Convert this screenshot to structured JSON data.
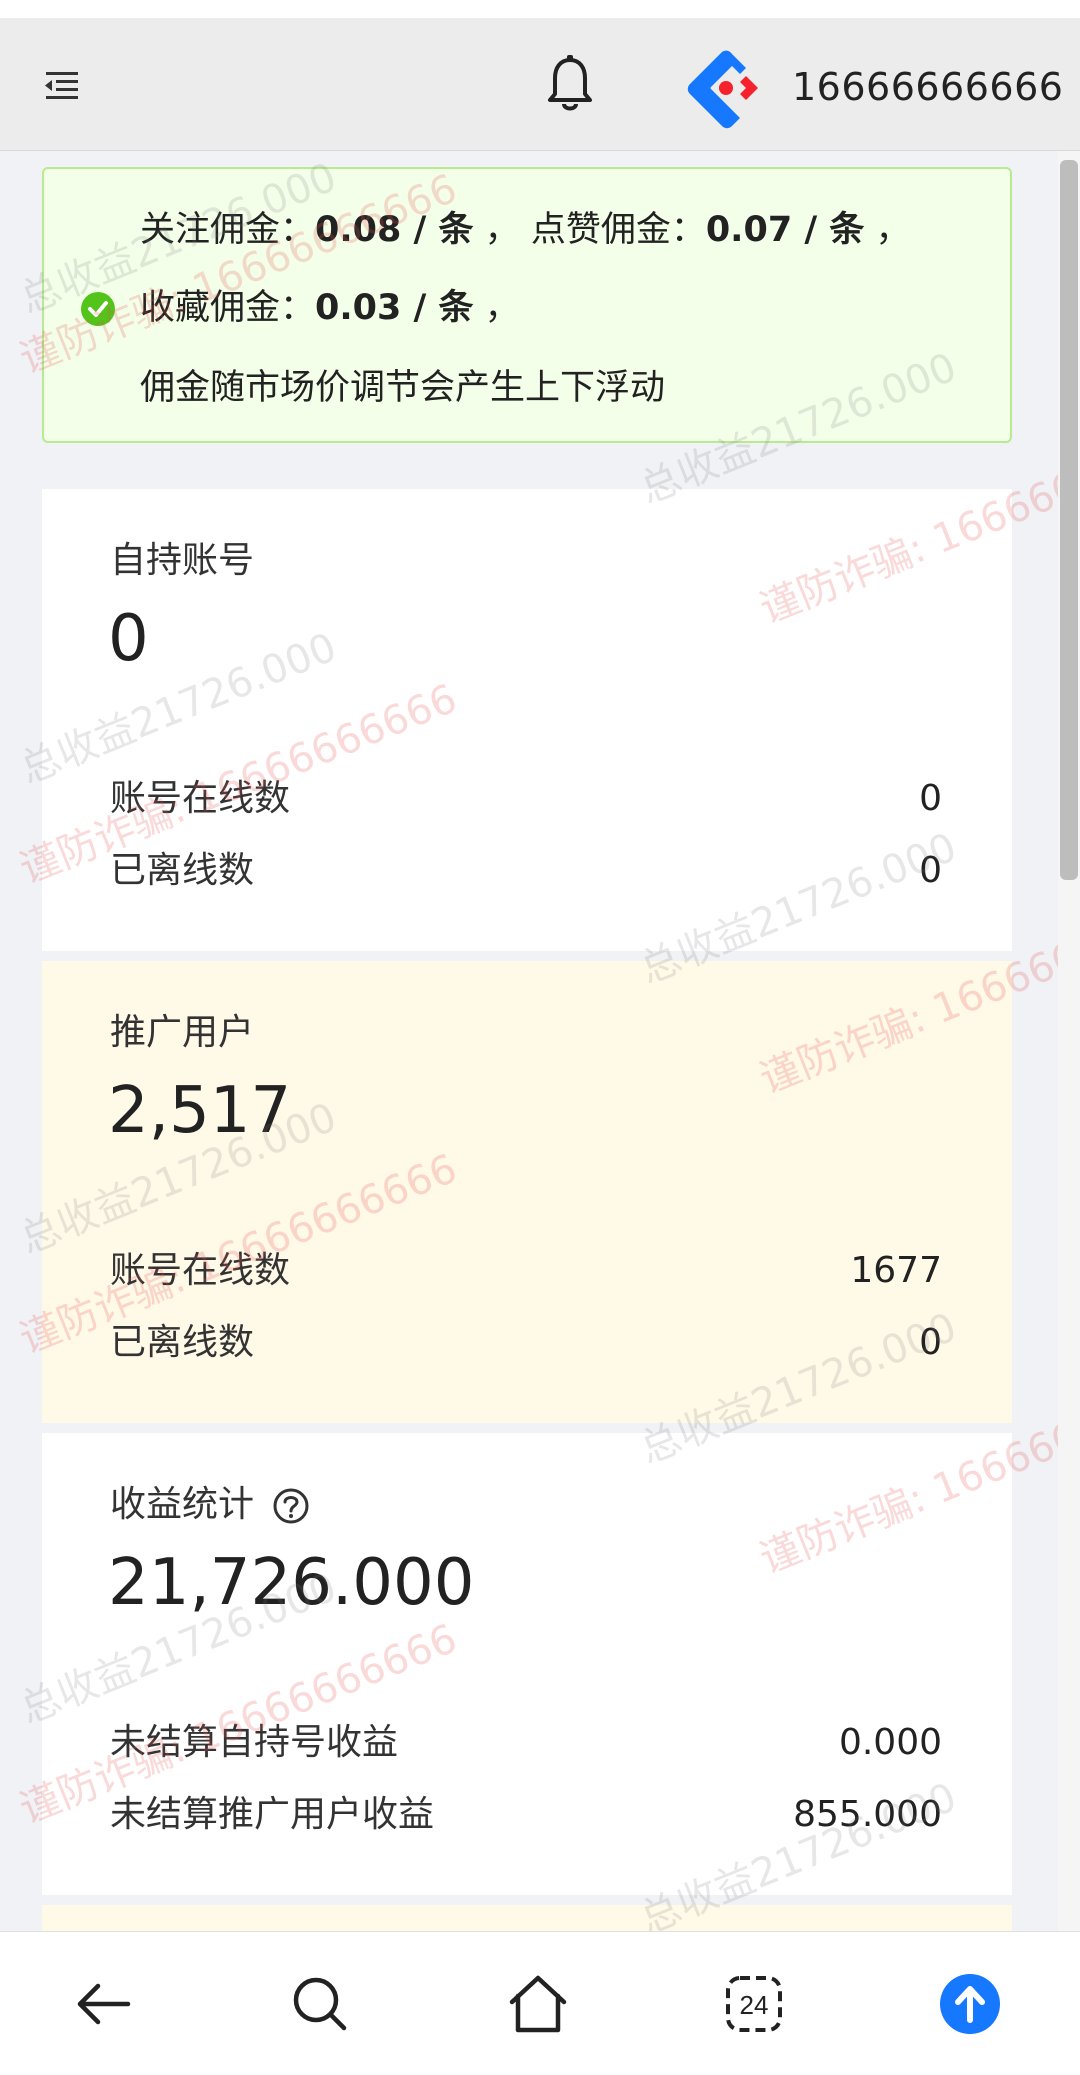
{
  "header": {
    "phone": "16666666666",
    "icons": {
      "menu": "menu-fold-icon",
      "bell": "bell-icon",
      "logo": "ant-design-logo"
    }
  },
  "alert": {
    "line1": {
      "label1": "关注佣金：",
      "value1": "0.08 / 条",
      "sep1": " ，",
      "label2": "点赞佣金：",
      "value2": "0.07 / 条",
      "sep2": " ，"
    },
    "line2": {
      "label": "收藏佣金：",
      "value": "0.03 / 条",
      "sep": " ，"
    },
    "line3": "佣金随市场价调节会产生上下浮动",
    "icon": "check-circle-icon",
    "icon_color": "#52c41a"
  },
  "cards": [
    {
      "title": "自持账号",
      "value": "0",
      "rows": [
        {
          "label": "账号在线数",
          "value": "0"
        },
        {
          "label": "已离线数",
          "value": "0"
        }
      ]
    },
    {
      "title": "推广用户",
      "value": "2,517",
      "rows": [
        {
          "label": "账号在线数",
          "value": "1677"
        },
        {
          "label": "已离线数",
          "value": "0"
        }
      ]
    },
    {
      "title": "收益统计",
      "value": "21,726.000",
      "rows": [
        {
          "label": "未结算自持号收益",
          "value": "0.000"
        },
        {
          "label": "未结算推广用户收益",
          "value": "855.000"
        }
      ]
    }
  ],
  "watermark": {
    "grey": "总收益21726.000",
    "red": "谨防诈骗: 16666666666"
  },
  "nav": {
    "items": [
      "back-arrow-icon",
      "search-icon",
      "home-icon",
      "tabs-icon",
      "upload-icon"
    ],
    "tabs_count": "24",
    "accent": "#1677ff"
  },
  "colors": {
    "alert_bg": "#f4ffe9",
    "alert_border": "#b7eb8f",
    "card_yellow": "#fff9e8"
  }
}
